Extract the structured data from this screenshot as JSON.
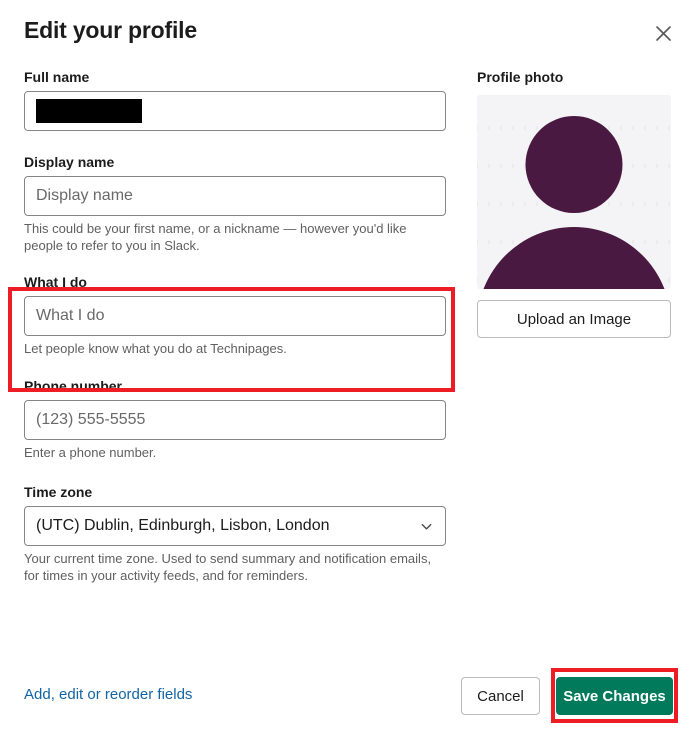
{
  "dialog": {
    "title": "Edit your profile",
    "close_icon": "close-icon"
  },
  "fields": {
    "full_name": {
      "label": "Full name",
      "value": "",
      "value_redacted": true,
      "placeholder": ""
    },
    "display_name": {
      "label": "Display name",
      "value": "",
      "placeholder": "Display name",
      "helper": "This could be your first name, or a nickname — however you'd like people to refer to you in Slack."
    },
    "what_i_do": {
      "label": "What I do",
      "value": "",
      "placeholder": "What I do",
      "helper": "Let people know what you do at Technipages."
    },
    "phone_number": {
      "label": "Phone number",
      "value": "",
      "placeholder": "(123) 555-5555",
      "helper": "Enter a phone number."
    },
    "time_zone": {
      "label": "Time zone",
      "value": "(UTC) Dublin, Edinburgh, Lisbon, London",
      "helper": "Your current time zone. Used to send summary and notification emails, for times in your activity feeds, and for reminders.",
      "chevron_icon": "chevron-down-icon"
    }
  },
  "photo": {
    "label": "Profile photo",
    "avatar_icon": "person-avatar-icon",
    "upload_label": "Upload an Image"
  },
  "footer": {
    "reorder_link": "Add, edit or reorder fields",
    "cancel_label": "Cancel",
    "save_label": "Save Changes"
  },
  "annotations": [
    {
      "name": "what-i-do-highlight",
      "color": "#ee1c25"
    },
    {
      "name": "save-changes-highlight",
      "color": "#ee1c25"
    }
  ],
  "colors": {
    "accent_green": "#007a5a",
    "link_blue": "#1264a3",
    "avatar_purple": "#4a1942",
    "annotation_red": "#ee1c25",
    "text_primary": "#1d1c1d",
    "text_secondary": "#616061",
    "border": "#868686"
  }
}
